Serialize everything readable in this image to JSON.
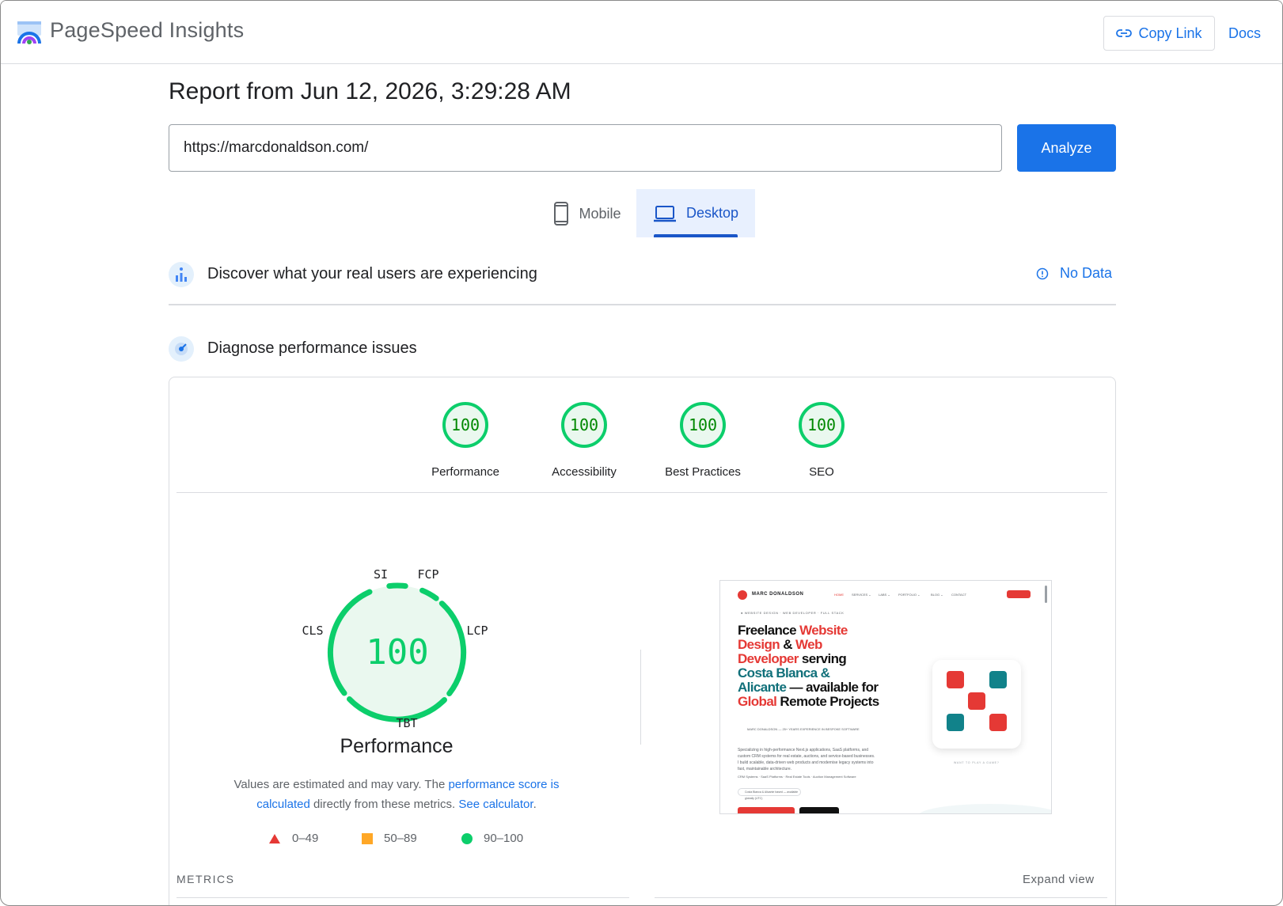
{
  "header": {
    "brand": "PageSpeed Insights",
    "copy_link_label": "Copy Link",
    "docs_label": "Docs"
  },
  "report": {
    "title": "Report from Jun 12, 2026, 3:29:28 AM"
  },
  "search": {
    "url_value": "https://marcdonaldson.com/",
    "analyze_label": "Analyze"
  },
  "tabs": [
    {
      "label": "Mobile",
      "selected": false
    },
    {
      "label": "Desktop",
      "selected": true
    }
  ],
  "field_data": {
    "title": "Discover what your real users are experiencing",
    "status": "No Data"
  },
  "diagnose": {
    "title": "Diagnose performance issues"
  },
  "scores": [
    {
      "label": "Performance",
      "value": "100"
    },
    {
      "label": "Accessibility",
      "value": "100"
    },
    {
      "label": "Best Practices",
      "value": "100"
    },
    {
      "label": "SEO",
      "value": "100"
    }
  ],
  "performance": {
    "score": "100",
    "title": "Performance",
    "gauge_labels": {
      "si": "SI",
      "fcp": "FCP",
      "lcp": "LCP",
      "tbt": "TBT",
      "cls": "CLS"
    },
    "note_prefix": "Values are estimated and may vary. The ",
    "note_link1": "performance score is calculated",
    "note_middle": " directly from these metrics. ",
    "note_link2": "See calculator",
    "note_suffix": "."
  },
  "legend": [
    {
      "range": "0–49",
      "color": "#e53935",
      "shape": "triangle"
    },
    {
      "range": "50–89",
      "color": "#ffa726",
      "shape": "square"
    },
    {
      "range": "90–100",
      "color": "#0cce6b",
      "shape": "circle"
    }
  ],
  "preview": {
    "logo_text": "MARC DONALDSON",
    "menu": [
      "HOME",
      "SERVICES ⌄",
      "LABS ⌄",
      "PORTFOLIO ⌄",
      "BLOG ⌄",
      "CONTACT"
    ],
    "tagline": "● WEBSITE DESIGN · WEB DEVELOPER · FULL STACK",
    "headline": {
      "w1": "Freelance ",
      "w2": "Website Design",
      "w3": " & ",
      "w4": "Web Developer",
      "w5": " serving ",
      "w6": "Costa Blanca & Alicante",
      "w7": " — available for ",
      "w8": "Global",
      "w9": " Remote Projects"
    },
    "subline": "MARC DONALDSON — 25+ YEARS EXPERIENCE IN BESPOKE SOFTWARE",
    "body": "Specializing in high-performance Next.js applications, SaaS platforms, and custom CRM systems for real estate, auctions, and service-based businesses. I build scalable, data-driven web products and modernise legacy systems into fast, maintainable architecture.",
    "body2": "CRM Systems · SaaS Platforms · Real Estate Tools · Auction Management Software",
    "pill": "Costa Blanca & Alicante based — available globally (UTC)",
    "play_label": "WANT TO PLAY A GAME?"
  },
  "metrics": {
    "label": "METRICS",
    "expand_label": "Expand view"
  },
  "colors": {
    "accent": "#1a73e8",
    "good": "#0cce6b",
    "good_text": "#008800",
    "good_bg": "#eaf8ef"
  }
}
